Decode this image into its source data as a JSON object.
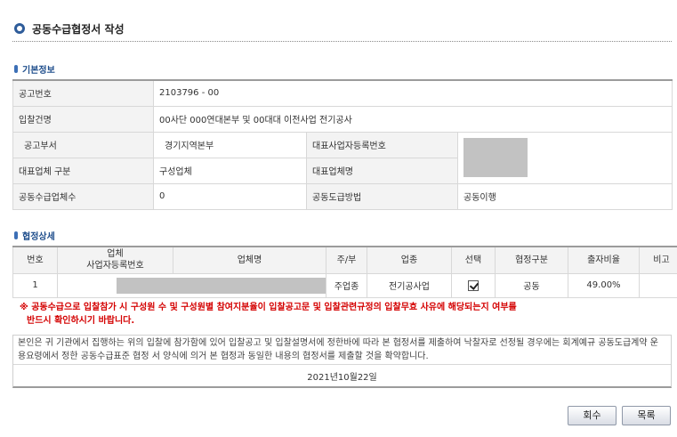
{
  "page": {
    "title": "공동수급협정서 작성"
  },
  "basic_info": {
    "section_title": "기본정보",
    "notice_no_label": "공고번호",
    "notice_no": "2103796 - 00",
    "bid_name_label": "입찰건명",
    "bid_name": "00사단 000연대본부 및 00대대 이전사업 전기공사",
    "dept_label": "공고부서",
    "dept": "경기지역본부",
    "rep_regno_label": "대표사업자등록번호",
    "rep_company_type_label": "대표업체 구분",
    "rep_company_type": "구성업체",
    "rep_company_name_label": "대표업체명",
    "joint_count_label": "공동수급업체수",
    "joint_count": "0",
    "joint_method_label": "공동도급방법",
    "joint_method": "공동이행"
  },
  "detail": {
    "section_title": "협정상세",
    "columns": {
      "no": "번호",
      "company_line1": "업체",
      "company_line2": "사업자등록번호",
      "company_name": "업체명",
      "main_sub": "주/부",
      "industry": "업종",
      "select": "선택",
      "agreement_type": "협정구분",
      "ratio": "출자비율",
      "remarks": "비고"
    },
    "rows": [
      {
        "no": "1",
        "main_sub": "주업종",
        "industry": "전기공사업",
        "selected": true,
        "agreement_type": "공동",
        "ratio": "49.00%",
        "remarks": ""
      }
    ]
  },
  "warning": {
    "line1": "※ 공동수급으로 입찰참가 시 구성원 수 및 구성원별 참여지분율이 입찰공고문 및 입찰관련규정의 입찰무효 사유에 해당되는지 여부를",
    "line2": "반드시 확인하시기 바랍니다."
  },
  "agreement": {
    "text": "본인은 귀 기관에서 집행하는 위의 입찰에 참가함에 있어 입찰공고 및 입찰설명서에 정한바에 따라 본 협정서를 제출하여 낙찰자로 선정될 경우에는 회계예규 공동도급계약 운용요령에서 정한 공동수급표준 협정 서 양식에 의거 본 협정과 동일한 내용의 협정서를 제출할 것을 확약합니다.",
    "date": "2021년10월22일"
  },
  "buttons": {
    "withdraw": "회수",
    "list": "목록"
  },
  "colors": {
    "accent": "#2e5c9a",
    "warning": "#d40000",
    "label_bg": "#f3f3f3",
    "masked": "#c2c2c2"
  },
  "icons": {
    "title": "circle-bullet-icon",
    "section": "section-bar-icon",
    "check": "checkmark-icon"
  }
}
